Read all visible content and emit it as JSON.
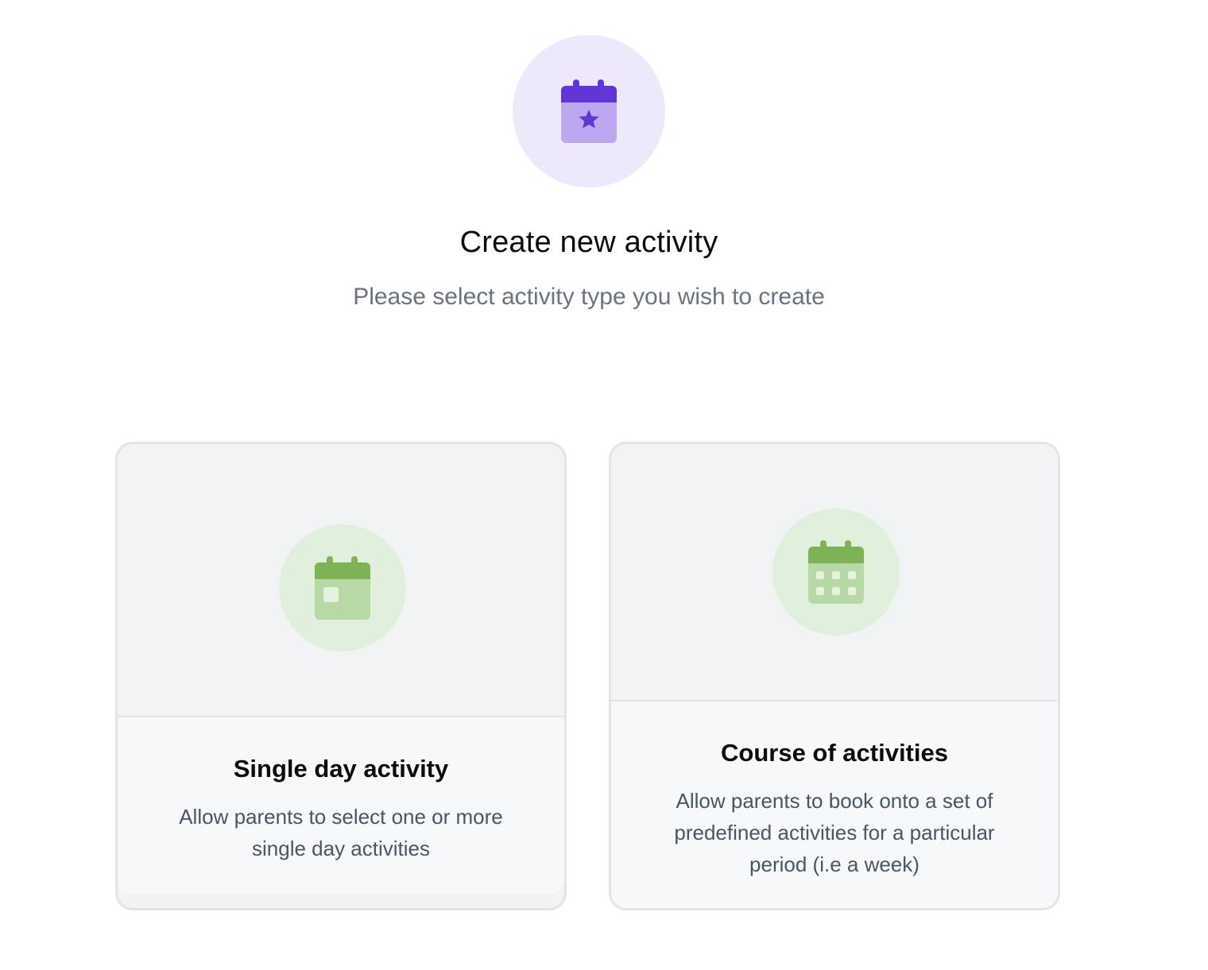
{
  "header": {
    "icon": "calendar-star-icon",
    "title": "Create new activity",
    "subtitle": "Please select activity type you wish to create"
  },
  "options": [
    {
      "icon": "calendar-single-day-icon",
      "title": "Single day activity",
      "description": "Allow parents to select one or more single day activities"
    },
    {
      "icon": "calendar-grid-icon",
      "title": "Course of activities",
      "description": "Allow parents to book onto a set of predefined activities for a particular period (i.e a week)"
    }
  ],
  "colors": {
    "accent_purple": "#6135d6",
    "purple_light": "#bda7f0",
    "purple_bg": "#ede8fa",
    "accent_green": "#7db356",
    "green_light": "#b8d9a6",
    "green_bg": "#e1f0dc"
  }
}
